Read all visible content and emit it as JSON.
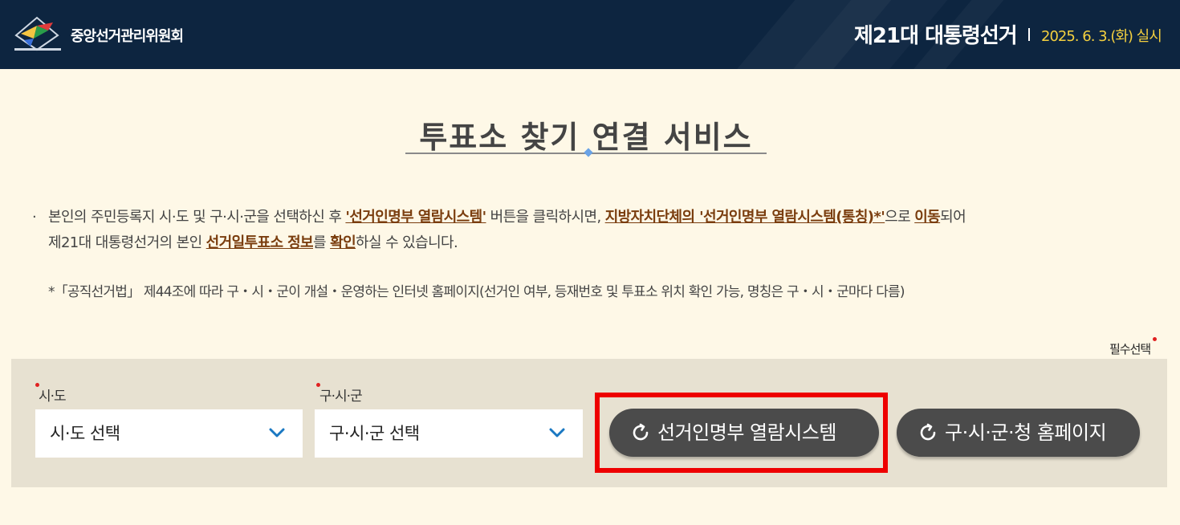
{
  "header": {
    "org_name": "중앙선거관리위원회",
    "election_title": "제21대 대통령선거",
    "election_date": "2025. 6. 3.(화) 실시"
  },
  "title": "투표소 찾기 연결 서비스",
  "description": {
    "bullet": "·",
    "line1_pre": "본인의 주민등록지 시·도 및 구·시·군을 선택하신 후 ",
    "line1_em1": "'선거인명부 열람시스템'",
    "line1_mid": " 버튼을 클릭하시면, ",
    "line1_em2": "지방자치단체의 '선거인명부 열람시스템(통칭)*'",
    "line1_mid2": "으로 ",
    "line1_em3": "이동",
    "line1_post": "되어",
    "line2_pre": "제21대 대통령선거의 본인 ",
    "line2_em1": "선거일투표소 정보",
    "line2_mid": "를 ",
    "line2_em2": "확인",
    "line2_post": "하실 수 있습니다.",
    "note": "*「공직선거법」 제44조에 따라 구・시・군이 개설・운영하는 인터넷 홈페이지(선거인 여부, 등재번호 및 투표소 위치 확인 가능, 명칭은 구・시・군마다 다름)"
  },
  "required_label": "필수선택",
  "form": {
    "sido_label": "시·도",
    "sido_value": "시·도 선택",
    "gusigun_label": "구·시·군",
    "gusigun_value": "구·시·군 선택",
    "voter_list_button": "선거인명부 열람시스템",
    "homepage_button": "구·시·군·청 홈페이지"
  },
  "colors": {
    "header_bg": "#0d2540",
    "page_bg": "#fef8e7",
    "panel_bg": "#e7e1d1",
    "button_bg": "#4b4b4b",
    "emphasis": "#7a3d0e",
    "date_yellow": "#f4d03f",
    "highlight_red": "#ee0000",
    "chevron_blue": "#1a78c2"
  }
}
